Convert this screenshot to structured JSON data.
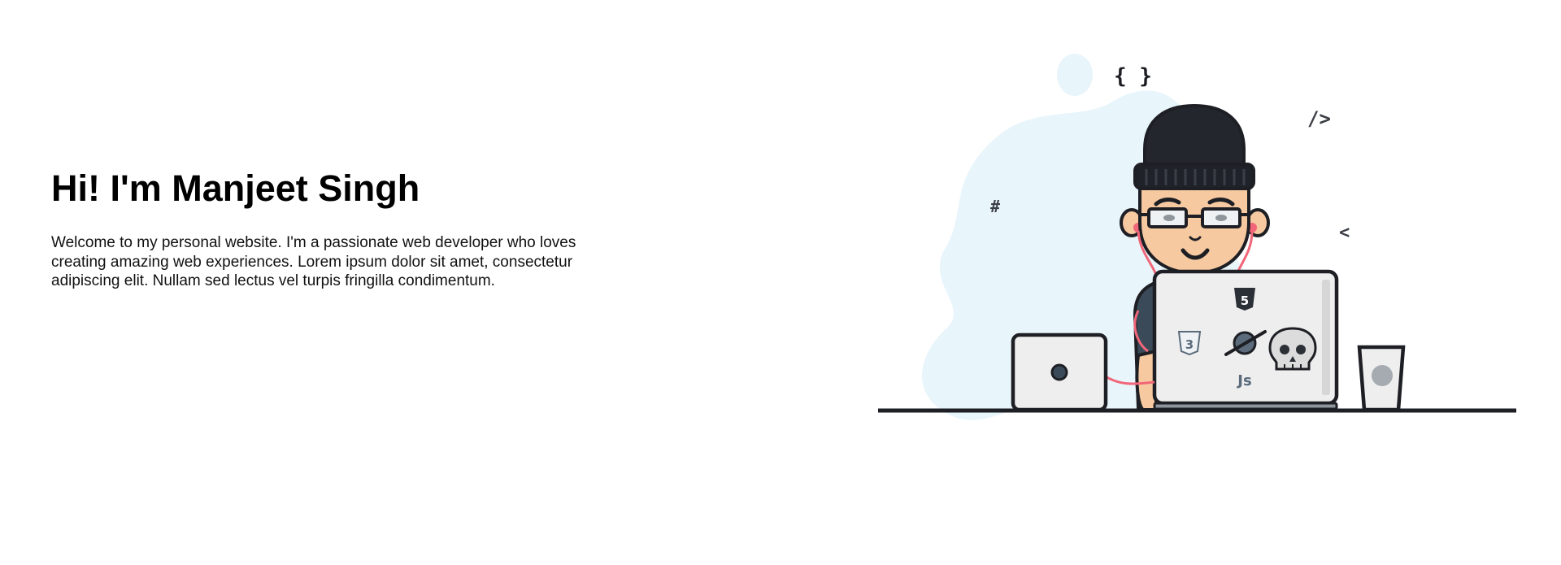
{
  "hero": {
    "title": "Hi! I'm Manjeet Singh",
    "description": "Welcome to my personal website. I'm a passionate web developer who loves creating amazing web experiences. Lorem ipsum dolor sit amet, consectetur adipiscing elit. Nullam sed lectus vel turpis fringilla condimentum."
  },
  "illustration": {
    "symbols": {
      "braces": "{ }",
      "slash_tag": "/>",
      "hash": "#",
      "angle": "<"
    },
    "laptop_badges": {
      "html": "5",
      "css": "3",
      "js": "Js"
    },
    "icons": [
      "developer-avatar-icon",
      "beanie-icon",
      "glasses-icon",
      "earphones-icon",
      "laptop-icon",
      "html5-icon",
      "css3-icon",
      "planet-icon",
      "skull-icon",
      "tablet-icon",
      "cup-icon"
    ],
    "colors": {
      "blob": "#e8f5fa",
      "outline": "#1d1f24",
      "skin": "#f7c9a0",
      "laptop": "#eeeeee",
      "cable": "#f2667a",
      "badge": "#5b6b7b"
    }
  }
}
